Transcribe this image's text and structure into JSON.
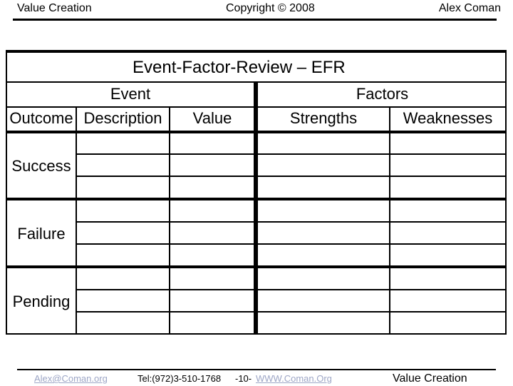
{
  "header": {
    "left": "Value Creation",
    "center": "Copyright © 2008",
    "right": "Alex Coman"
  },
  "table": {
    "title": "Event-Factor-Review – EFR",
    "group_headers": {
      "event": "Event",
      "factors": "Factors"
    },
    "columns": {
      "outcome": "Outcome",
      "description": "Description",
      "value": "Value",
      "strengths": "Strengths",
      "weaknesses": "Weaknesses"
    },
    "rows": [
      {
        "outcome": "Success",
        "entries": [
          {
            "description": "",
            "value": "",
            "strengths": "",
            "weaknesses": ""
          },
          {
            "description": "",
            "value": "",
            "strengths": "",
            "weaknesses": ""
          },
          {
            "description": "",
            "value": "",
            "strengths": "",
            "weaknesses": ""
          }
        ]
      },
      {
        "outcome": "Failure",
        "entries": [
          {
            "description": "",
            "value": "",
            "strengths": "",
            "weaknesses": ""
          },
          {
            "description": "",
            "value": "",
            "strengths": "",
            "weaknesses": ""
          },
          {
            "description": "",
            "value": "",
            "strengths": "",
            "weaknesses": ""
          }
        ]
      },
      {
        "outcome": "Pending",
        "entries": [
          {
            "description": "",
            "value": "",
            "strengths": "",
            "weaknesses": ""
          },
          {
            "description": "",
            "value": "",
            "strengths": "",
            "weaknesses": ""
          },
          {
            "description": "",
            "value": "",
            "strengths": "",
            "weaknesses": ""
          }
        ]
      }
    ]
  },
  "footer": {
    "email": "Alex@Coman.org",
    "tel": "Tel:(972)3-510-1768",
    "page": "-10-",
    "website": "WWW.Coman.Org",
    "right": "Value Creation",
    "link_color": "#9da6c6"
  }
}
